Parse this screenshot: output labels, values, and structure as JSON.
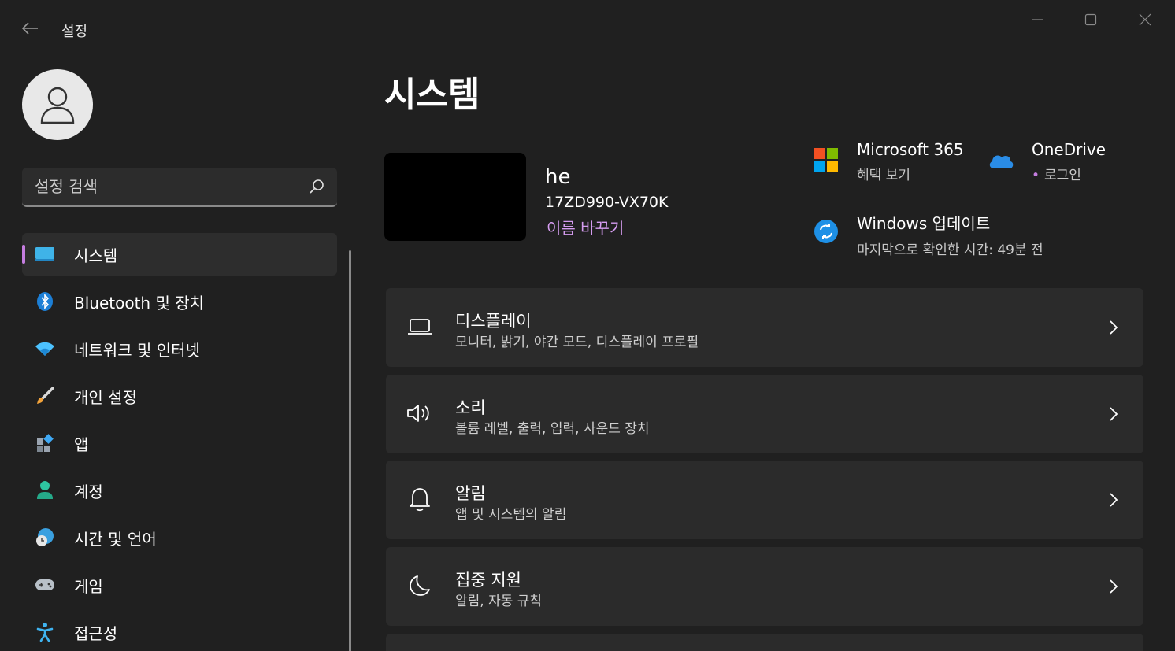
{
  "window": {
    "title": "설정",
    "controls": [
      "minimize",
      "maximize",
      "close"
    ]
  },
  "sidebar": {
    "search": {
      "placeholder": "설정 검색"
    },
    "items": [
      {
        "label": "시스템",
        "icon": "monitor-icon",
        "active": true
      },
      {
        "label": "Bluetooth 및 장치",
        "icon": "bluetooth-icon"
      },
      {
        "label": "네트워크 및 인터넷",
        "icon": "wifi-icon"
      },
      {
        "label": "개인 설정",
        "icon": "paintbrush-icon"
      },
      {
        "label": "앱",
        "icon": "apps-icon"
      },
      {
        "label": "계정",
        "icon": "account-icon"
      },
      {
        "label": "시간 및 언어",
        "icon": "globe-clock-icon"
      },
      {
        "label": "게임",
        "icon": "gamepad-icon"
      },
      {
        "label": "접근성",
        "icon": "accessibility-icon"
      }
    ]
  },
  "main": {
    "title": "시스템",
    "device": {
      "name": "he",
      "model": "17ZD990-VX70K",
      "rename_label": "이름 바꾸기"
    },
    "tiles": {
      "m365": {
        "title": "Microsoft 365",
        "sub": "혜택 보기",
        "icon": "microsoft-logo-icon"
      },
      "onedrive": {
        "title": "OneDrive",
        "sub": "로그인",
        "icon": "onedrive-cloud-icon"
      },
      "update": {
        "title": "Windows 업데이트",
        "sub": "마지막으로 확인한 시간: 49분 전",
        "icon": "windows-update-icon"
      }
    },
    "cards": [
      {
        "title": "디스플레이",
        "sub": "모니터, 밝기, 야간 모드, 디스플레이 프로필",
        "icon": "laptop-icon"
      },
      {
        "title": "소리",
        "sub": "볼륨 레벨, 출력, 입력, 사운드 장치",
        "icon": "speaker-icon"
      },
      {
        "title": "알림",
        "sub": "앱 및 시스템의 알림",
        "icon": "bell-icon"
      },
      {
        "title": "집중 지원",
        "sub": "알림, 자동 규칙",
        "icon": "moon-icon"
      }
    ]
  },
  "colors": {
    "background": "#202020",
    "card": "#2b2b2b",
    "accent": "#c57de0",
    "link": "#d59cf0"
  }
}
